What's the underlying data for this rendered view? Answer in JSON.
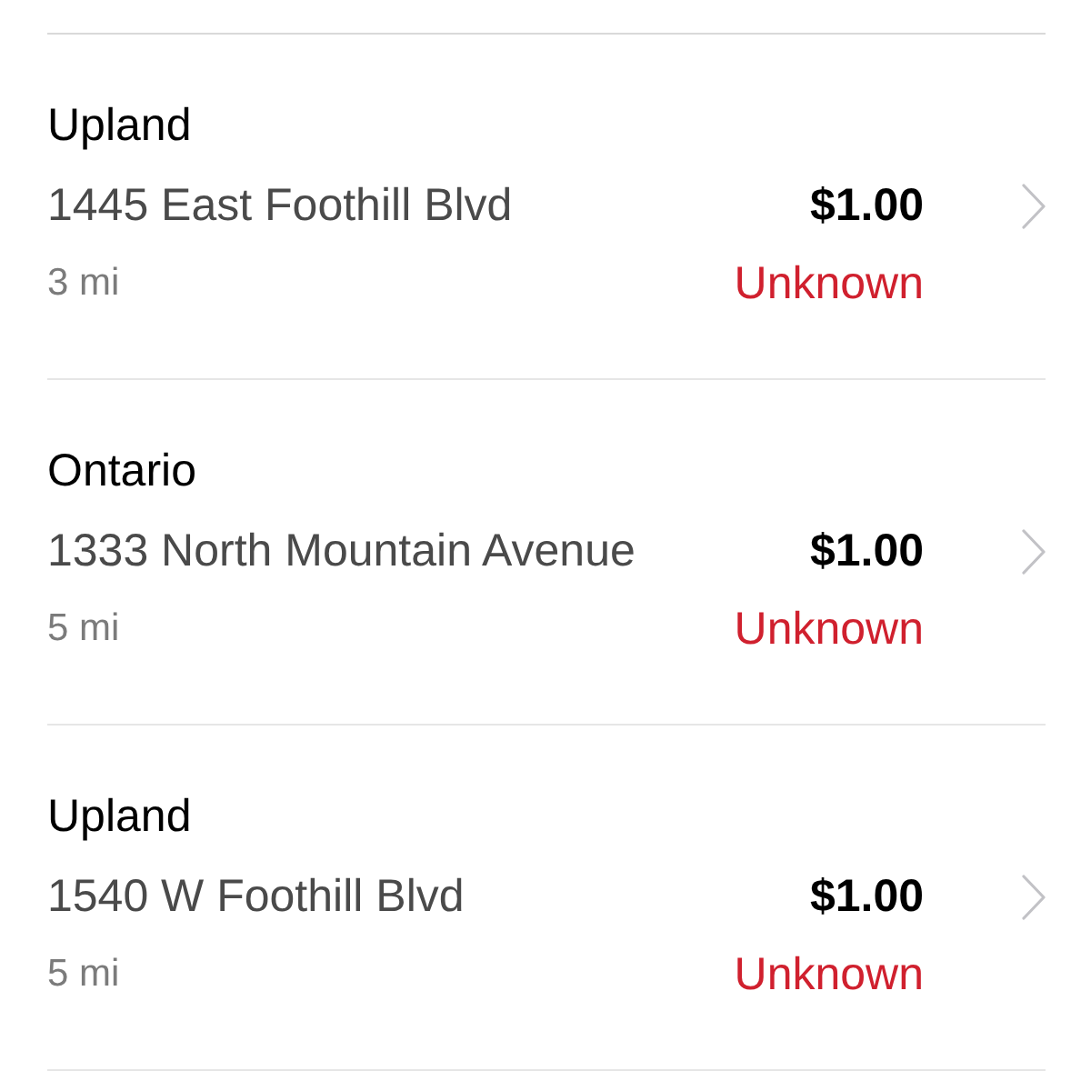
{
  "locations": [
    {
      "city": "Upland",
      "address": "1445 East Foothill Blvd",
      "price": "$1.00",
      "distance": "3 mi",
      "status": "Unknown"
    },
    {
      "city": "Ontario",
      "address": "1333 North Mountain Avenue",
      "price": "$1.00",
      "distance": "5 mi",
      "status": "Unknown"
    },
    {
      "city": "Upland",
      "address": "1540 W Foothill Blvd",
      "price": "$1.00",
      "distance": "5 mi",
      "status": "Unknown"
    }
  ]
}
